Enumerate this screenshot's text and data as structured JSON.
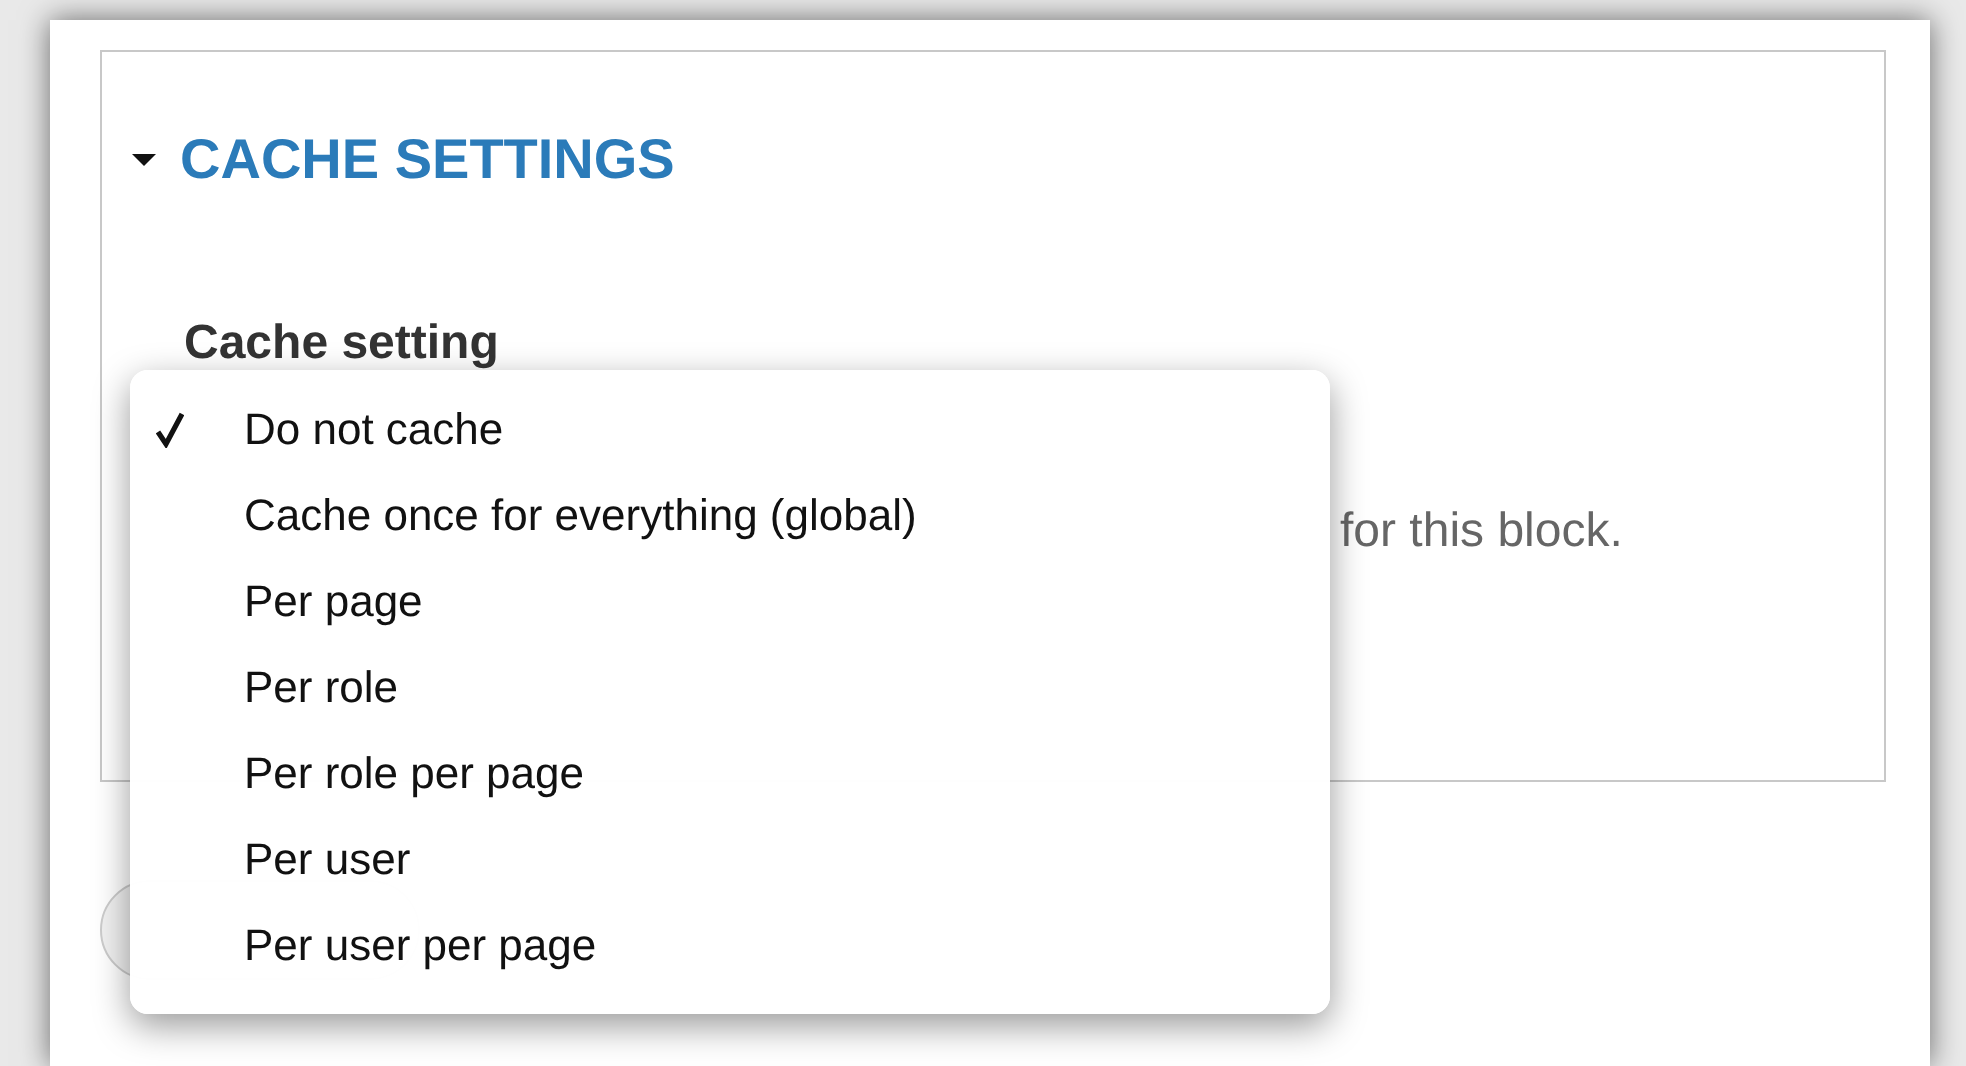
{
  "fieldset": {
    "legend": "CACHE SETTINGS",
    "expanded": true
  },
  "field": {
    "label": "Cache setting",
    "description": "for this block."
  },
  "menu": {
    "options": [
      {
        "label": "Do not cache",
        "selected": true
      },
      {
        "label": "Cache once for everything (global)",
        "selected": false
      },
      {
        "label": "Per page",
        "selected": false
      },
      {
        "label": "Per role",
        "selected": false
      },
      {
        "label": "Per role per page",
        "selected": false
      },
      {
        "label": "Per user",
        "selected": false
      },
      {
        "label": "Per user per page",
        "selected": false
      }
    ]
  }
}
